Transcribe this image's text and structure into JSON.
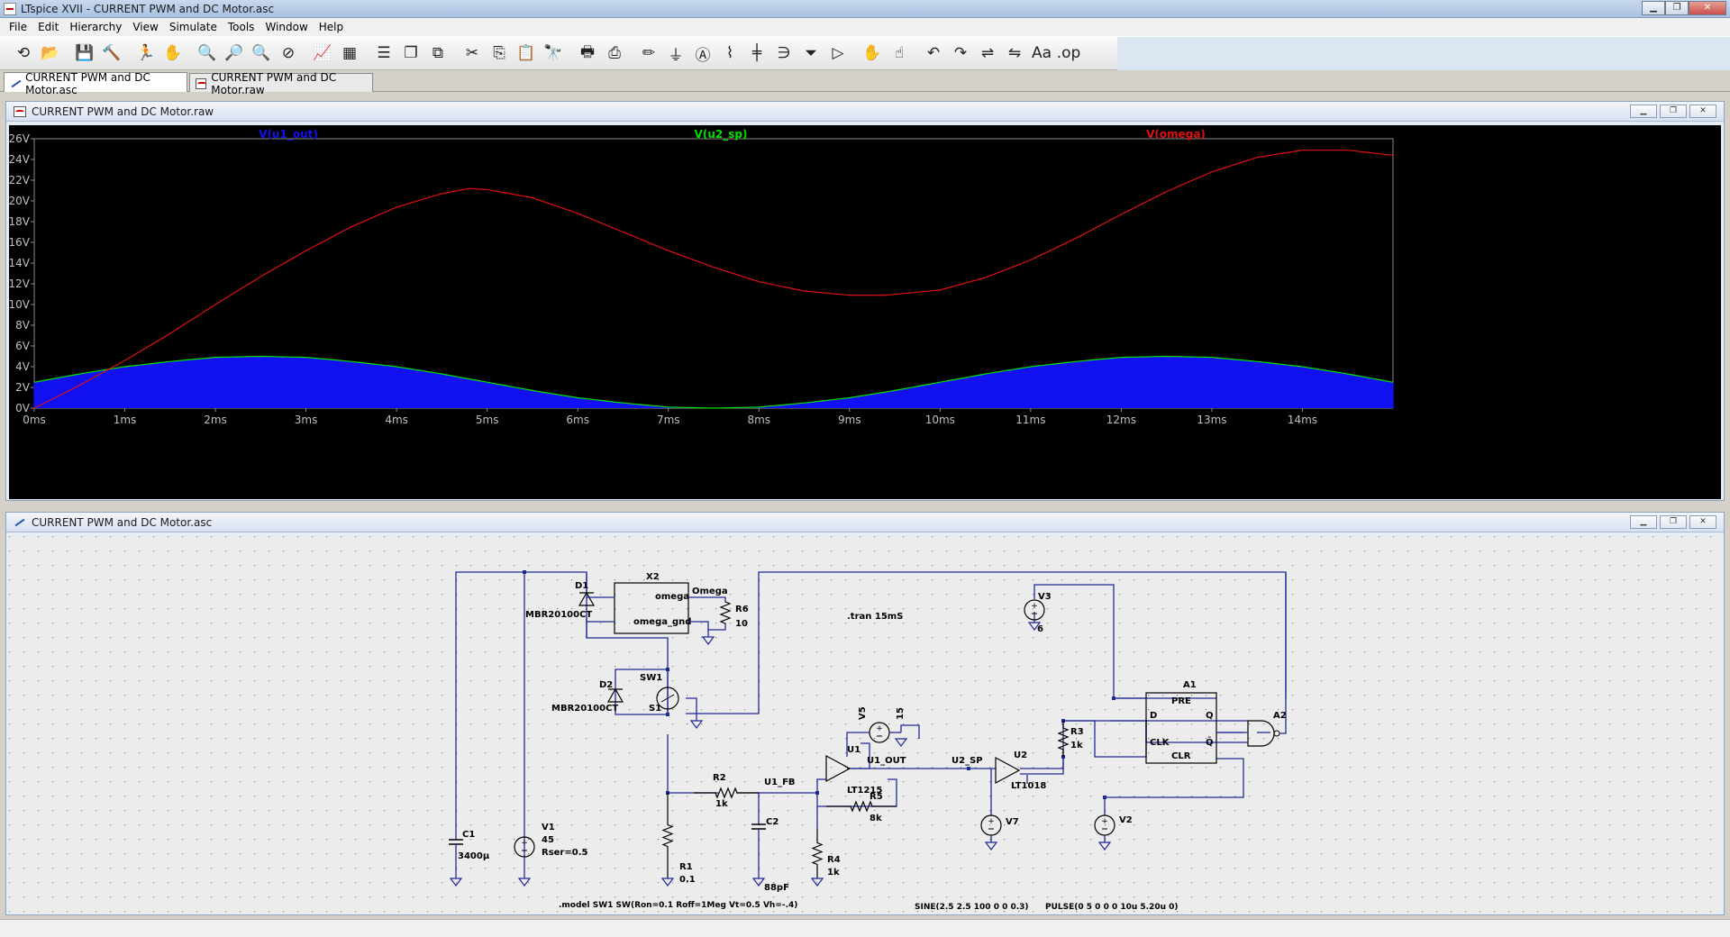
{
  "window": {
    "title": "LTspice XVII - CURRENT PWM and DC Motor.asc"
  },
  "menu": [
    "File",
    "Edit",
    "Hierarchy",
    "View",
    "Simulate",
    "Tools",
    "Window",
    "Help"
  ],
  "toolbar": [
    {
      "name": "open-schematic",
      "glyph": "⟲"
    },
    {
      "name": "open-file",
      "glyph": "📂"
    },
    {
      "name": "save",
      "glyph": "💾"
    },
    {
      "name": "control-panel",
      "glyph": "🔨"
    },
    {
      "name": "run",
      "glyph": "🏃"
    },
    {
      "name": "pan",
      "glyph": "✋"
    },
    {
      "name": "zoom-in",
      "glyph": "🔍"
    },
    {
      "name": "zoom-area",
      "glyph": "🔎"
    },
    {
      "name": "zoom-out",
      "glyph": "🔍"
    },
    {
      "name": "zoom-fit",
      "glyph": "⊘"
    },
    {
      "name": "autorange",
      "glyph": "📈"
    },
    {
      "name": "add-plot-pane",
      "glyph": "▦"
    },
    {
      "name": "tile-horizontal",
      "glyph": "☰"
    },
    {
      "name": "cascade",
      "glyph": "❐"
    },
    {
      "name": "tile-vertical",
      "glyph": "⧉"
    },
    {
      "name": "cut",
      "glyph": "✂"
    },
    {
      "name": "copy",
      "glyph": "⎘"
    },
    {
      "name": "paste",
      "glyph": "📋"
    },
    {
      "name": "find",
      "glyph": "🔭"
    },
    {
      "name": "print",
      "glyph": "🖶"
    },
    {
      "name": "print-setup",
      "glyph": "⎙"
    },
    {
      "name": "draw-wire",
      "glyph": "✏"
    },
    {
      "name": "ground",
      "glyph": "⏚"
    },
    {
      "name": "label-net",
      "glyph": "Ⓐ"
    },
    {
      "name": "resistor",
      "glyph": "⌇"
    },
    {
      "name": "capacitor",
      "glyph": "╪"
    },
    {
      "name": "inductor",
      "glyph": "∋"
    },
    {
      "name": "diode",
      "glyph": "⏷"
    },
    {
      "name": "component",
      "glyph": "▷"
    },
    {
      "name": "move",
      "glyph": "✋"
    },
    {
      "name": "drag",
      "glyph": "☝"
    },
    {
      "name": "undo",
      "glyph": "↶"
    },
    {
      "name": "redo",
      "glyph": "↷"
    },
    {
      "name": "rotate",
      "glyph": "⇌"
    },
    {
      "name": "mirror",
      "glyph": "⇋"
    },
    {
      "name": "text",
      "glyph": "Aa"
    },
    {
      "name": "spice-directive",
      "glyph": ".op"
    }
  ],
  "tabs": [
    {
      "label": "CURRENT PWM and DC Motor.asc",
      "active": true
    },
    {
      "label": "CURRENT PWM and DC Motor.raw",
      "active": false
    }
  ],
  "plot_window": {
    "title": "CURRENT PWM and DC Motor.raw"
  },
  "schematic_window": {
    "title": "CURRENT PWM and DC Motor.asc"
  },
  "chart_data": {
    "type": "line",
    "xlabel": "",
    "ylabel": "",
    "xlim": [
      0,
      15
    ],
    "ylim": [
      0,
      26
    ],
    "x_ticks": [
      "0ms",
      "1ms",
      "2ms",
      "3ms",
      "4ms",
      "5ms",
      "6ms",
      "7ms",
      "8ms",
      "9ms",
      "10ms",
      "11ms",
      "12ms",
      "13ms",
      "14ms"
    ],
    "y_ticks": [
      "0V",
      "2V",
      "4V",
      "6V",
      "8V",
      "10V",
      "12V",
      "14V",
      "16V",
      "18V",
      "20V",
      "22V",
      "24V",
      "26V"
    ],
    "grid": false,
    "background": "#000000",
    "series": [
      {
        "name": "V(u1_out)",
        "color": "#1010f0",
        "style": "pwm-filled",
        "x": [
          0,
          0.5,
          1,
          1.5,
          2,
          2.5,
          3,
          3.5,
          4,
          4.5,
          5,
          5.5,
          6,
          6.5,
          7,
          7.5,
          8,
          8.5,
          9,
          9.5,
          10,
          10.5,
          11,
          11.5,
          12,
          12.5,
          13,
          13.5,
          14,
          14.5,
          15
        ],
        "values": [
          2.5,
          3.3,
          4.0,
          4.5,
          4.9,
          5.0,
          4.9,
          4.5,
          4.0,
          3.3,
          2.5,
          1.7,
          1.0,
          0.5,
          0.1,
          0.0,
          0.1,
          0.5,
          1.0,
          1.7,
          2.5,
          3.3,
          4.0,
          4.5,
          4.9,
          5.0,
          4.9,
          4.5,
          4.0,
          3.3,
          2.5
        ]
      },
      {
        "name": "V(u2_sp)",
        "color": "#00e000",
        "x": [
          0,
          0.5,
          1,
          1.5,
          2,
          2.5,
          3,
          3.5,
          4,
          4.5,
          5,
          5.5,
          6,
          6.5,
          7,
          7.5,
          8,
          8.5,
          9,
          9.5,
          10,
          10.5,
          11,
          11.5,
          12,
          12.5,
          13,
          13.5,
          14,
          14.5,
          15
        ],
        "values": [
          2.5,
          3.3,
          4.0,
          4.5,
          4.9,
          5.0,
          4.9,
          4.5,
          4.0,
          3.3,
          2.5,
          1.7,
          1.0,
          0.5,
          0.1,
          0.0,
          0.1,
          0.5,
          1.0,
          1.7,
          2.5,
          3.3,
          4.0,
          4.5,
          4.9,
          5.0,
          4.9,
          4.5,
          4.0,
          3.3,
          2.5
        ]
      },
      {
        "name": "V(omega)",
        "color": "#e01010",
        "x": [
          0,
          0.5,
          1,
          1.5,
          2,
          2.5,
          3,
          3.5,
          4,
          4.5,
          4.8,
          5,
          5.5,
          6,
          6.5,
          7,
          7.5,
          8,
          8.5,
          9,
          9.4,
          10,
          10.5,
          11,
          11.5,
          12,
          12.5,
          13,
          13.5,
          14,
          14.5,
          15
        ],
        "values": [
          0,
          2.2,
          4.6,
          7.2,
          10.0,
          12.7,
          15.2,
          17.5,
          19.4,
          20.7,
          21.2,
          21.1,
          20.3,
          18.8,
          17.0,
          15.2,
          13.6,
          12.2,
          11.3,
          10.9,
          10.9,
          11.4,
          12.6,
          14.3,
          16.4,
          18.7,
          20.9,
          22.8,
          24.2,
          24.9,
          24.9,
          24.4
        ]
      }
    ]
  },
  "schematic": {
    "components": [
      {
        "ref": "X2",
        "pins": [
          "omega",
          "omega_gnd"
        ],
        "net": "Omega"
      },
      {
        "ref": "D1",
        "value": "MBR20100CT"
      },
      {
        "ref": "R6",
        "value": "10"
      },
      {
        "ref": "D2",
        "value": "MBR20100CT"
      },
      {
        "ref": "SW1",
        "value": "S1"
      },
      {
        "ref": "C1",
        "value": "3400µ"
      },
      {
        "ref": "V1",
        "value": "45",
        "extra": "Rser=0.5"
      },
      {
        "ref": "R1",
        "value": "0.1"
      },
      {
        "ref": "R2",
        "value": "1k"
      },
      {
        "ref": "C2",
        "value": "88pF"
      },
      {
        "ref": "U1",
        "value": "LT1215"
      },
      {
        "ref": "V5",
        "value": "15"
      },
      {
        "ref": "R4",
        "value": "1k"
      },
      {
        "ref": "R5",
        "value": "8k"
      },
      {
        "ref": "U2",
        "value": "LT1018"
      },
      {
        "ref": "V7",
        "value": ""
      },
      {
        "ref": "V3",
        "value": "6"
      },
      {
        "ref": "R3",
        "value": "1k"
      },
      {
        "ref": "A1",
        "pins": [
          "PRE",
          "D",
          "CLK",
          "CLR",
          "Q",
          "Q̄"
        ]
      },
      {
        "ref": "A2",
        "value": ""
      },
      {
        "ref": "V2",
        "value": ""
      }
    ],
    "net_labels": [
      "U1_FB",
      "U1_OUT",
      "U2_SP",
      "Omega"
    ],
    "directives": [
      ".tran 15mS",
      ".model SW1 SW(Ron=0.1 Roff=1Meg Vt=0.5 Vh=-.4)",
      "SINE(2.5 2.5 100 0 0 0.3)",
      "PULSE(0 5 0 0 0 10u 5.20u 0)"
    ]
  }
}
